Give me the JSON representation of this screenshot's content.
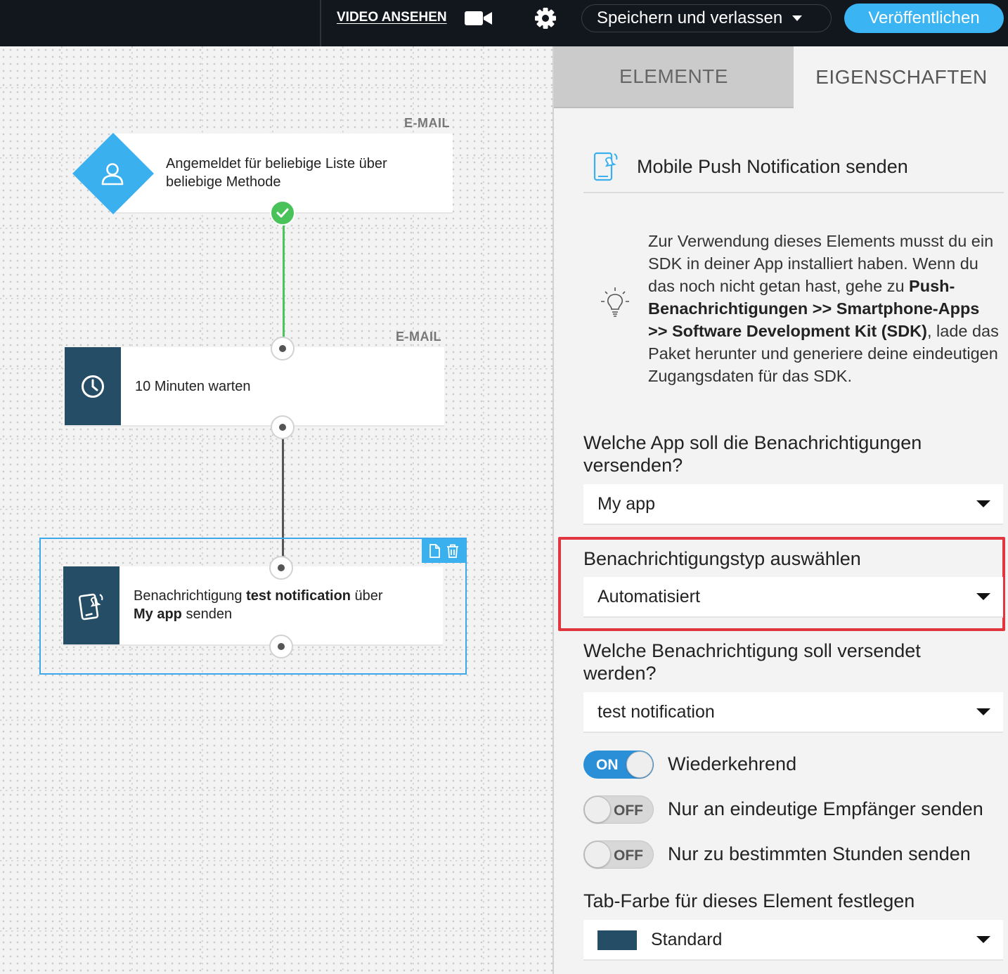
{
  "topbar": {
    "video_label": "VIDEO ANSEHEN",
    "save_label": "Speichern und verlassen",
    "publish_label": "Veröffentlichen",
    "accent": "#3ab4f2"
  },
  "canvas": {
    "nodes": [
      {
        "tag": "E-MAIL",
        "text": "Angemeldet für beliebige Liste über beliebige Methode",
        "icon": "user-icon"
      },
      {
        "tag": "E-MAIL",
        "text": "10 Minuten warten",
        "icon": "clock-icon"
      },
      {
        "text_pre": "Benachrichtigung ",
        "text_bold1": "test notification",
        "text_mid": " über",
        "text_bold2": "My app",
        "text_post": " senden",
        "icon": "mobile-push-icon"
      }
    ]
  },
  "panel": {
    "tabs": [
      {
        "label": "ELEMENTE",
        "active": false
      },
      {
        "label": "EIGENSCHAFTEN",
        "active": true
      }
    ],
    "title": "Mobile Push Notification senden",
    "info": {
      "part1": "Zur Verwendung dieses Elements musst du ein SDK in deiner App installiert haben. Wenn du das noch nicht getan hast, gehe zu ",
      "bold": "Push-Benachrichtigungen >> Smartphone-Apps >> Software Development Kit (SDK)",
      "part2": ", lade das Paket herunter und generiere deine eindeutigen Zugangsdaten für das SDK."
    },
    "app_question": "Welche App soll die Benachrichtigungen versenden?",
    "app_value": "My app",
    "type_label": "Benachrichtigungstyp auswählen",
    "type_value": "Automatisiert",
    "notification_question": "Welche Benachrichtigung soll versendet werden?",
    "notification_value": "test notification",
    "toggles": [
      {
        "state": "ON",
        "label": "Wiederkehrend"
      },
      {
        "state": "OFF",
        "label": "Nur an eindeutige Empfänger senden"
      },
      {
        "state": "OFF",
        "label": "Nur zu bestimmten Stunden senden"
      }
    ],
    "color_label": "Tab-Farbe für dieses Element festlegen",
    "color_value": "Standard",
    "color_swatch": "#254e66",
    "highlight_color": "#e2363e"
  }
}
